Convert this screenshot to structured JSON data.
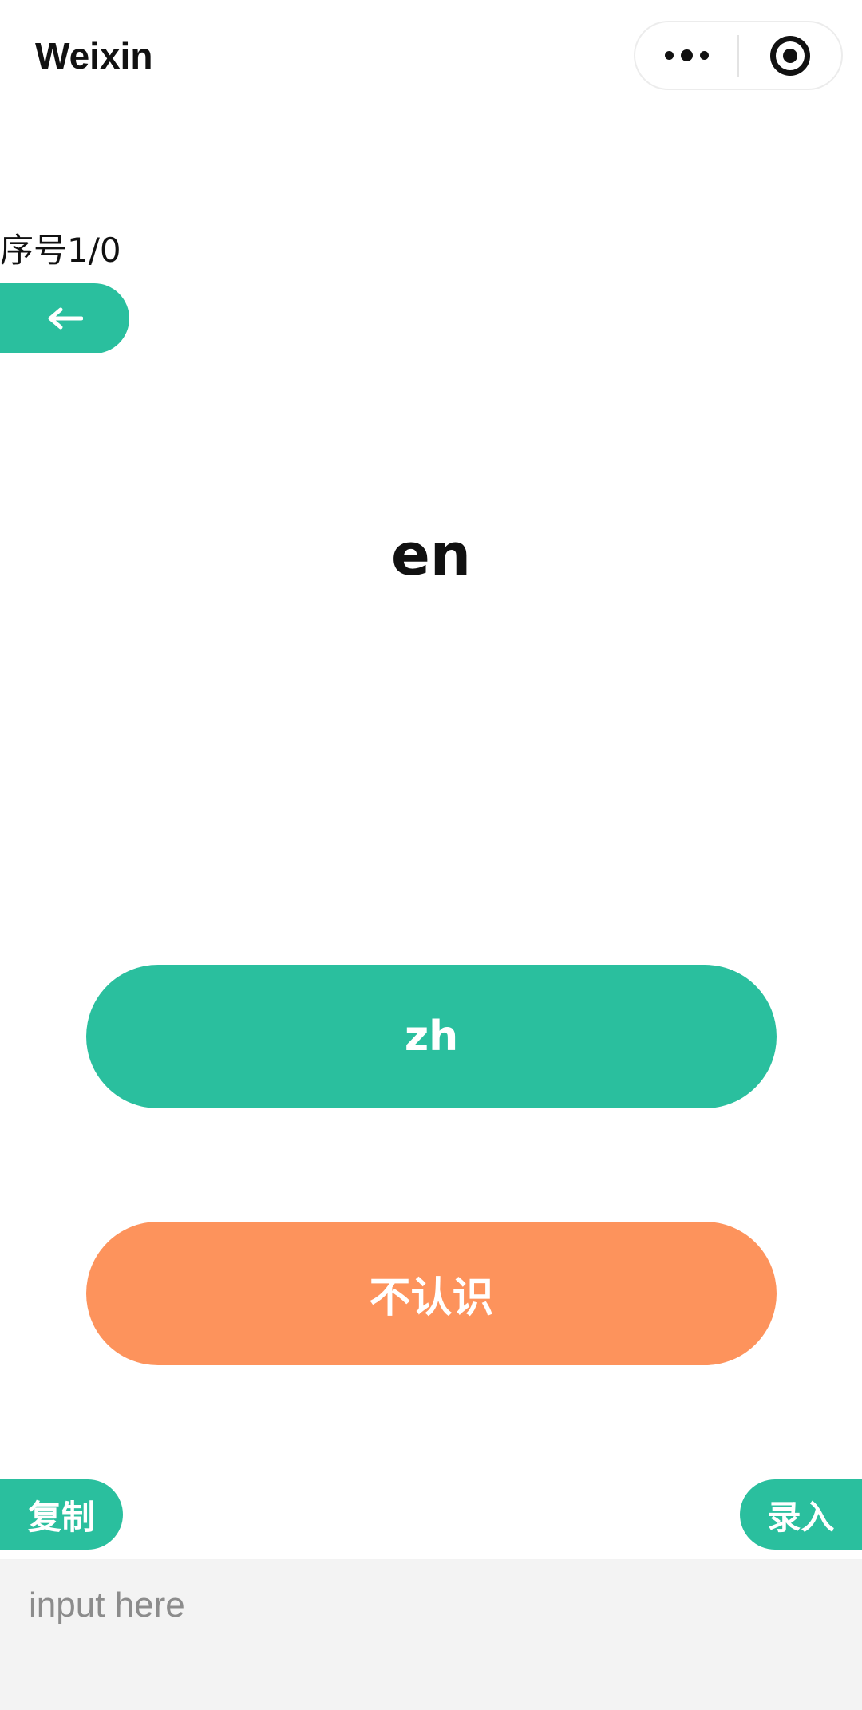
{
  "app": {
    "title": "Weixin"
  },
  "capsule": {
    "menu_icon": "more-dots-icon",
    "close_icon": "target-circle-icon"
  },
  "progress": {
    "index_text": "序号1/0"
  },
  "back_button": {
    "icon": "arrow-left-icon"
  },
  "card": {
    "word": "en"
  },
  "actions": {
    "known_label": "zh",
    "unknown_label": "不认识"
  },
  "tools": {
    "copy_label": "复制",
    "enter_label": "录入"
  },
  "input": {
    "placeholder": "input here",
    "value": ""
  },
  "colors": {
    "accent_green": "#2abf9e",
    "accent_orange": "#fd935c",
    "input_background": "#f3f3f3"
  }
}
